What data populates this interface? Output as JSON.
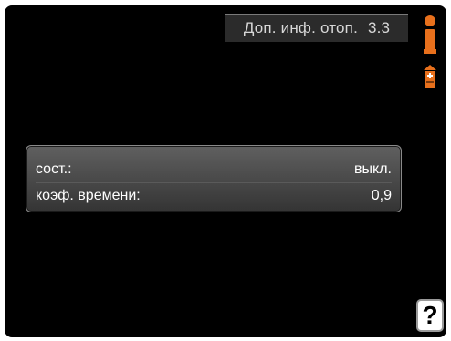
{
  "header": {
    "title": "Доп. инф. отоп.",
    "menu_number": "3.3"
  },
  "menu": {
    "rows": [
      {
        "label": "сост.:",
        "value": "выкл."
      },
      {
        "label": "коэф. времени:",
        "value": "0,9"
      }
    ]
  },
  "icons": {
    "info": "info-icon",
    "heating": "heating-icon",
    "help": "help-icon"
  },
  "help_button": {
    "label": "?"
  },
  "colors": {
    "accent": "#e8701c",
    "background": "#000000",
    "text": "#ffffff"
  }
}
